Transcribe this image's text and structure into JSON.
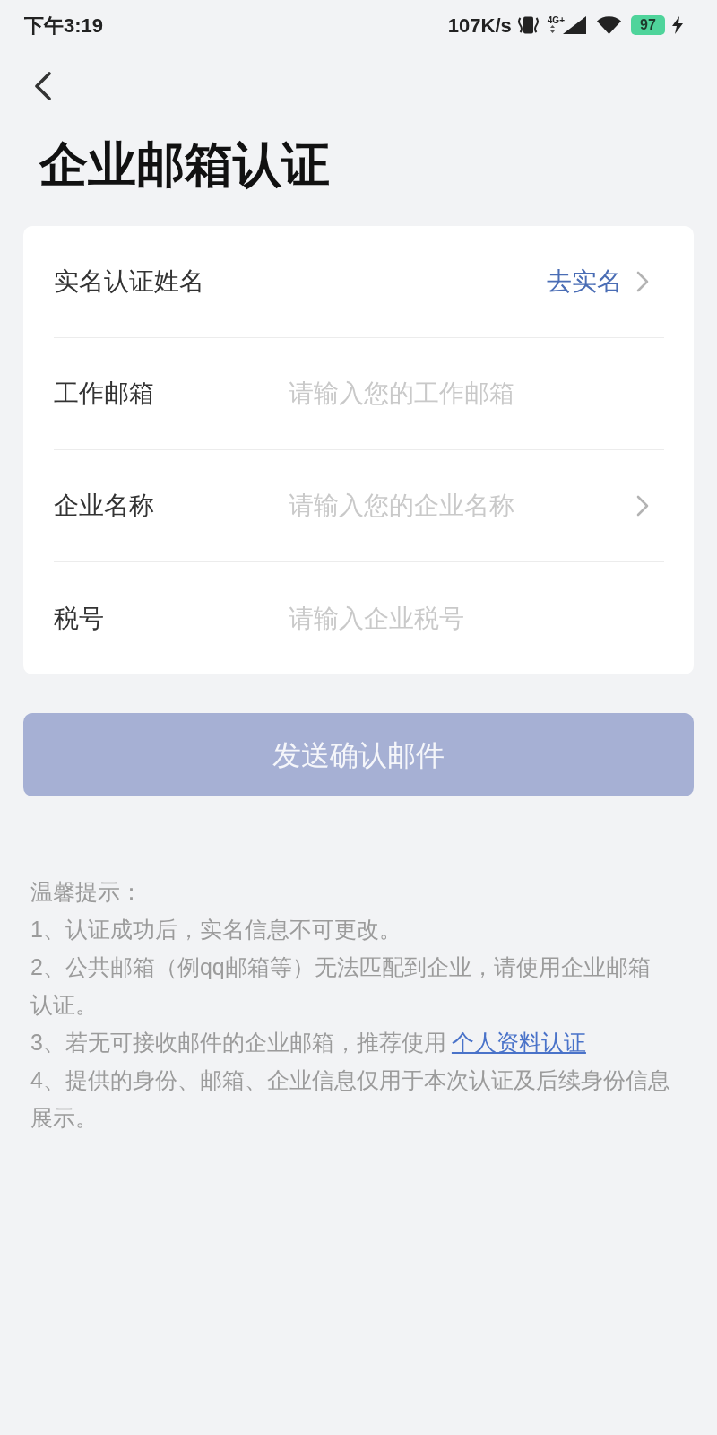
{
  "status_bar": {
    "time": "下午3:19",
    "network_speed": "107K/s",
    "network_type": "4G+",
    "battery": "97"
  },
  "header": {
    "title": "企业邮箱认证"
  },
  "form": {
    "rows": [
      {
        "kind": "action",
        "label": "实名认证姓名",
        "value": "去实名"
      },
      {
        "kind": "input",
        "label": "工作邮箱",
        "placeholder": "请输入您的工作邮箱"
      },
      {
        "kind": "picker",
        "label": "企业名称",
        "placeholder": "请输入您的企业名称"
      },
      {
        "kind": "input",
        "label": "税号",
        "placeholder": "请输入企业税号"
      }
    ]
  },
  "submit_button": {
    "label": "发送确认邮件",
    "disabled": true
  },
  "tips": {
    "title": "温馨提示：",
    "items": [
      {
        "text": "1、认证成功后，实名信息不可更改。"
      },
      {
        "text": "2、公共邮箱（例qq邮箱等）无法匹配到企业，请使用企业邮箱认证。"
      },
      {
        "text": "3、若无可接收邮件的企业邮箱，推荐使用",
        "link": "个人资料认证"
      },
      {
        "text": "4、提供的身份、邮箱、企业信息仅用于本次认证及后续身份信息展示。"
      }
    ]
  }
}
